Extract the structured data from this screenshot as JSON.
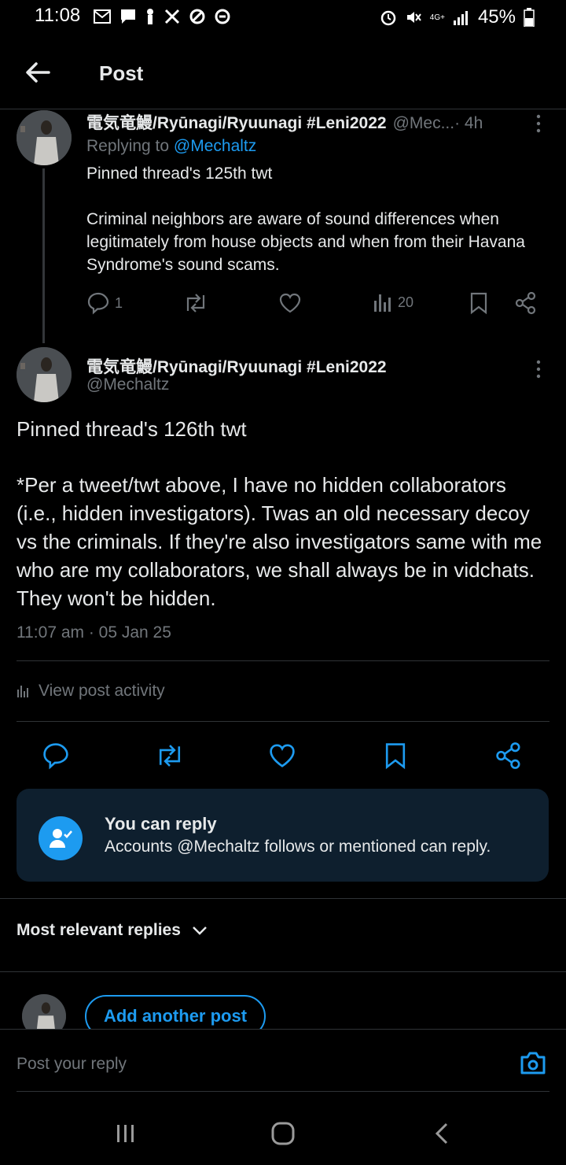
{
  "status_bar": {
    "time": "11:08",
    "battery": "45%",
    "network": "4G+"
  },
  "header": {
    "title": "Post"
  },
  "parent_post": {
    "author_name": "電気竜鰻/Ryūnagi/Ryuunagi #Leni2022",
    "handle": "@Mec...",
    "time_sep": " · 4h",
    "replying_prefix": "Replying to ",
    "replying_handle": "@Mechaltz",
    "text_line1": "Pinned thread's 125th twt",
    "text_para2": "Criminal neighbors are aware of sound differences when legitimately from house objects and when from their Havana Syndrome's sound scams.",
    "reply_count": "1",
    "views": "20"
  },
  "main_post": {
    "author_name": "電気竜鰻/Ryūnagi/Ryuunagi #Leni2022",
    "handle": "@Mechaltz",
    "text_line1": "Pinned thread's 126th twt",
    "text_para2": "*Per a tweet/twt above, I have no hidden collaborators (i.e., hidden investigators). Twas an old necessary decoy vs the criminals. If they're also investigators same with me who are my collaborators, we shall always be in vidchats. They won't be hidden.",
    "timestamp": "11:07 am · 05 Jan 25",
    "view_activity": "View post activity"
  },
  "reply_notice": {
    "title": "You can reply",
    "subtitle": "Accounts @Mechaltz follows or mentioned can reply."
  },
  "replies_sort": {
    "label": "Most relevant replies"
  },
  "add_post": {
    "label": "Add another post"
  },
  "composer": {
    "placeholder": "Post your reply"
  },
  "colors": {
    "accent": "#1d9bf0",
    "muted": "#71767b",
    "background": "#000000",
    "card": "#0e1f2e"
  }
}
